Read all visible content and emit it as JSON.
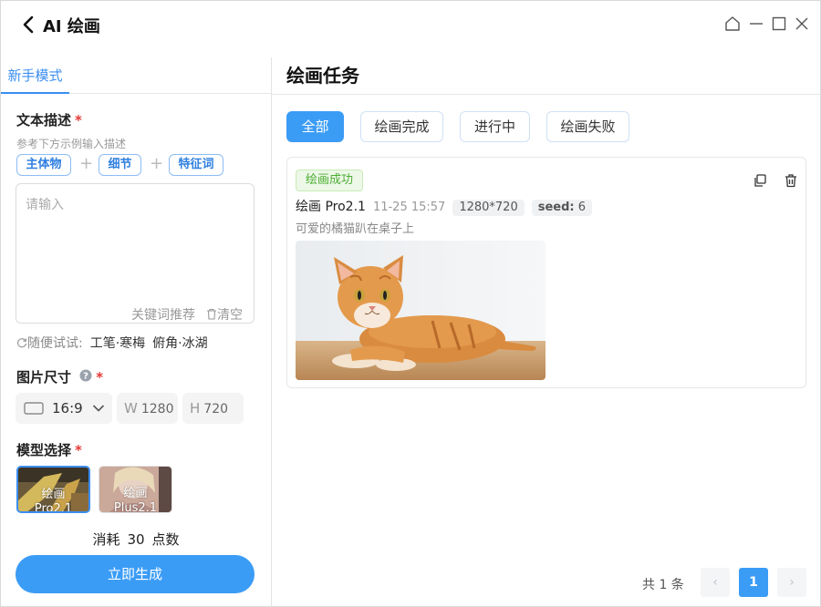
{
  "window": {
    "title": "AI 绘画"
  },
  "left": {
    "tab_label": "新手模式",
    "text_desc": {
      "label": "文本描述",
      "required_mark": "*",
      "hint": "参考下方示例输入描述",
      "chips": [
        "主体物",
        "细节",
        "特征词"
      ],
      "plus": "+",
      "placeholder": "请输入",
      "keyword_btn": "关键词推荐",
      "clear_btn": "清空"
    },
    "try_row": {
      "label": "随便试试:",
      "items": [
        "工笔·寒梅",
        "俯角·冰湖"
      ]
    },
    "image_size": {
      "label": "图片尺寸",
      "required_mark": "*",
      "ratio": "16:9",
      "width_prefix": "W",
      "width_value": "1280",
      "height_prefix": "H",
      "height_value": "720"
    },
    "model": {
      "label": "模型选择",
      "required_mark": "*",
      "options": [
        {
          "line1": "绘画",
          "line2": "Pro2.1",
          "selected": true
        },
        {
          "line1": "绘画",
          "line2": "Plus2.1",
          "selected": false
        }
      ]
    },
    "cost": {
      "prefix": "消耗",
      "value": "30",
      "unit": "点数"
    },
    "generate_btn": "立即生成"
  },
  "right": {
    "title": "绘画任务",
    "filters": [
      {
        "label": "全部",
        "active": true
      },
      {
        "label": "绘画完成",
        "active": false
      },
      {
        "label": "进行中",
        "active": false
      },
      {
        "label": "绘画失败",
        "active": false
      }
    ],
    "task": {
      "status": "绘画成功",
      "model": "绘画 Pro2.1",
      "time": "11-25 15:57",
      "size": "1280*720",
      "seed_label": "seed:",
      "seed_value": "6",
      "desc": "可爱的橘猫趴在桌子上"
    },
    "pagination": {
      "total": "共 1 条",
      "current": "1",
      "prev": "‹",
      "next": "›"
    }
  },
  "colors": {
    "accent": "#3b9cf6",
    "success": "#4cae32",
    "required": "#e53935"
  }
}
